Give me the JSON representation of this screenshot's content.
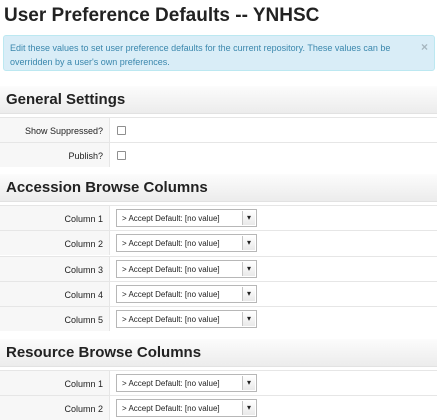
{
  "page": {
    "title": "User Preference Defaults -- YNHSC"
  },
  "alert": {
    "text": "Edit these values to set user preference defaults for the current repository. These values can be overridden by a user's own preferences.",
    "close": "×"
  },
  "general": {
    "heading": "General Settings",
    "show_suppressed": {
      "label": "Show Suppressed?",
      "checked": false
    },
    "publish": {
      "label": "Publish?",
      "checked": false
    }
  },
  "accession": {
    "heading": "Accession Browse Columns",
    "columns": [
      {
        "label": "Column 1",
        "value": "> Accept Default: [no value]"
      },
      {
        "label": "Column 2",
        "value": "> Accept Default: [no value]"
      },
      {
        "label": "Column 3",
        "value": "> Accept Default: [no value]"
      },
      {
        "label": "Column 4",
        "value": "> Accept Default: [no value]"
      },
      {
        "label": "Column 5",
        "value": "> Accept Default: [no value]"
      }
    ]
  },
  "resource": {
    "heading": "Resource Browse Columns",
    "columns": [
      {
        "label": "Column 1",
        "value": "> Accept Default: [no value]"
      },
      {
        "label": "Column 2",
        "value": "> Accept Default: [no value]"
      }
    ]
  },
  "icons": {
    "dropdown_arrow": "chevron-down-icon",
    "close": "close-icon"
  }
}
